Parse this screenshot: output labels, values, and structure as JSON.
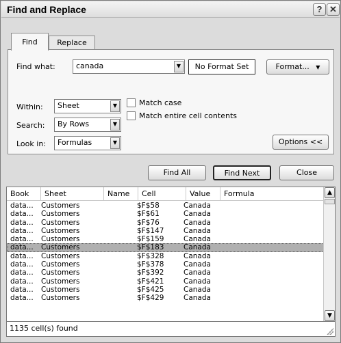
{
  "window": {
    "title": "Find and Replace",
    "help_glyph": "?",
    "close_glyph": "✕"
  },
  "tabs": {
    "find": "Find",
    "replace": "Replace"
  },
  "find": {
    "find_what_label": "Find what:",
    "find_what_value": "canada",
    "format_status": "No Format Set",
    "format_button": "Format...",
    "within_label": "Within:",
    "within_value": "Sheet",
    "search_label": "Search:",
    "search_value": "By Rows",
    "lookin_label": "Look in:",
    "lookin_value": "Formulas",
    "match_case_label": "Match case",
    "match_entire_label": "Match entire cell contents",
    "options_button": "Options <<"
  },
  "actions": {
    "find_all": "Find All",
    "find_next": "Find Next",
    "close": "Close"
  },
  "results": {
    "columns": [
      "Book",
      "Sheet",
      "Name",
      "Cell",
      "Value",
      "Formula"
    ],
    "rows": [
      [
        "data...",
        "Customers",
        "",
        "$F$58",
        "Canada",
        ""
      ],
      [
        "data...",
        "Customers",
        "",
        "$F$61",
        "Canada",
        ""
      ],
      [
        "data...",
        "Customers",
        "",
        "$F$76",
        "Canada",
        ""
      ],
      [
        "data...",
        "Customers",
        "",
        "$F$147",
        "Canada",
        ""
      ],
      [
        "data...",
        "Customers",
        "",
        "$F$159",
        "Canada",
        ""
      ],
      [
        "data...",
        "Customers",
        "",
        "$F$183",
        "Canada",
        ""
      ],
      [
        "data...",
        "Customers",
        "",
        "$F$328",
        "Canada",
        ""
      ],
      [
        "data...",
        "Customers",
        "",
        "$F$378",
        "Canada",
        ""
      ],
      [
        "data...",
        "Customers",
        "",
        "$F$392",
        "Canada",
        ""
      ],
      [
        "data...",
        "Customers",
        "",
        "$F$421",
        "Canada",
        ""
      ],
      [
        "data...",
        "Customers",
        "",
        "$F$425",
        "Canada",
        ""
      ],
      [
        "data...",
        "Customers",
        "",
        "$F$429",
        "Canada",
        ""
      ]
    ],
    "selected_row_index": 5
  },
  "status": {
    "text": "1135 cell(s) found"
  },
  "icons": {
    "dropdown": "chevron-down-icon",
    "scroll_up": "scroll-up-icon",
    "scroll_down": "scroll-down-icon"
  }
}
